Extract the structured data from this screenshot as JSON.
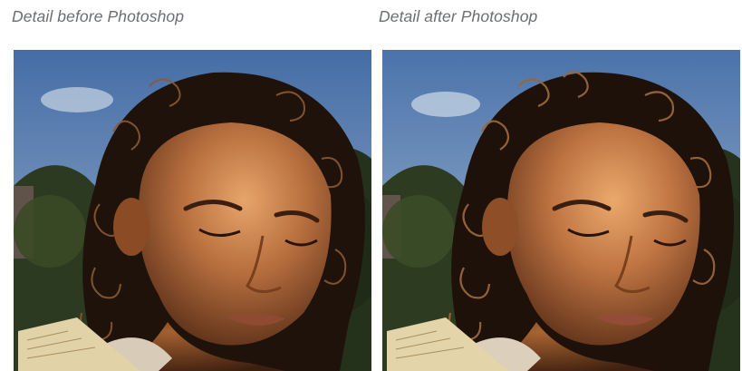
{
  "captions": {
    "before": "Detail before Photoshop",
    "after": "Detail after Photoshop"
  },
  "images": {
    "before": {
      "subject": "portrait of curly-haired girl looking down in warm sunlight, trees and sky behind",
      "variant": "before-retouch"
    },
    "after": {
      "subject": "portrait of curly-haired girl looking down in warm sunlight, trees and sky behind",
      "variant": "after-retouch"
    }
  },
  "colors": {
    "caption_text": "#6b6e72",
    "sky": "#4f74a8",
    "foliage": "#24321c",
    "skin_light": "#d9945a",
    "skin_shadow": "#5a2f18",
    "hair": "#1e120b"
  }
}
